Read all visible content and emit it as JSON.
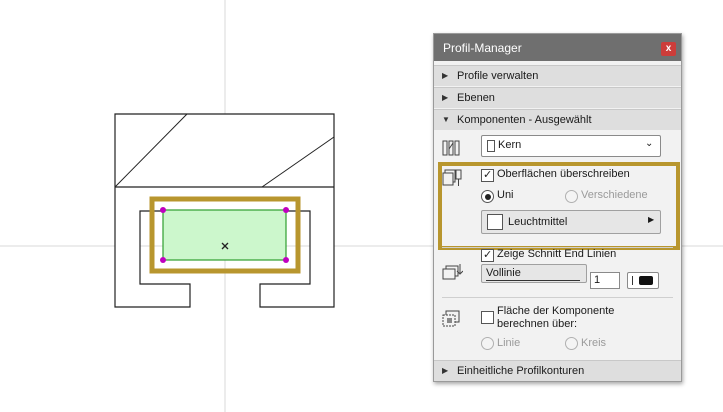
{
  "palette": {
    "title": "Profil-Manager",
    "close_glyph": "x",
    "sections": {
      "profiles": "Profile verwalten",
      "layers": "Ebenen",
      "components": "Komponenten - Ausgewählt",
      "contours": "Einheitliche Profilkonturen"
    },
    "component_dropdown": {
      "value": "Kern"
    },
    "surfaces": {
      "override_label": "Oberflächen überschreiben",
      "override_checked": true,
      "radio_uni": "Uni",
      "radio_different": "Verschiedene",
      "material_value": "Leuchtmittel"
    },
    "end_lines": {
      "label": "Zeige Schnitt End Linien",
      "checked": true,
      "line_type_value": "Vollinie",
      "pen_value": "1"
    },
    "area_calc": {
      "label_line1": "Fläche der Komponente",
      "label_line2": "berechnen über:",
      "checked": false,
      "radio_line": "Linie",
      "radio_circle": "Kreis"
    }
  },
  "colors": {
    "highlight_frame": "#b8962e",
    "component_fill": "#ccf7cc",
    "component_stroke": "#2e9e2e",
    "hotspot": "#c000c0",
    "titlebar": "#6f6f6f",
    "close": "#cc3d3a"
  },
  "icons": [
    "components-icon",
    "surface-override-icon",
    "end-lines-icon",
    "area-calc-icon"
  ]
}
